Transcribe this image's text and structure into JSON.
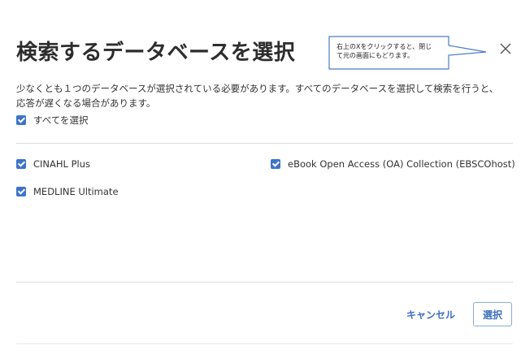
{
  "dialog": {
    "title": "検索するデータベースを選択",
    "description_line1": "少なくとも１つのデータベースが選択されている必要があります。すべてのデータベースを選択して検索を行うと、",
    "description_line2": "応答が遅くなる場合があります。",
    "select_all_label": "すべてを選択",
    "select_all_checked": true,
    "close_icon": "close-icon",
    "databases": [
      {
        "label": "CINAHL Plus",
        "checked": true
      },
      {
        "label": "MEDLINE Ultimate",
        "checked": true
      },
      {
        "label": "eBook Open Access (OA) Collection (EBSCOhost)",
        "checked": true
      }
    ],
    "cancel_label": "キャンセル",
    "select_label": "選択"
  },
  "callout": {
    "line1": "右上のXをクリックすると、閉じ",
    "line2": "て元の画面にもどります。"
  },
  "colors": {
    "accent": "#3d6fc0",
    "checkbox": "#3d74c9",
    "callout_border": "#4a7cc4",
    "divider": "#dcdcdc"
  }
}
